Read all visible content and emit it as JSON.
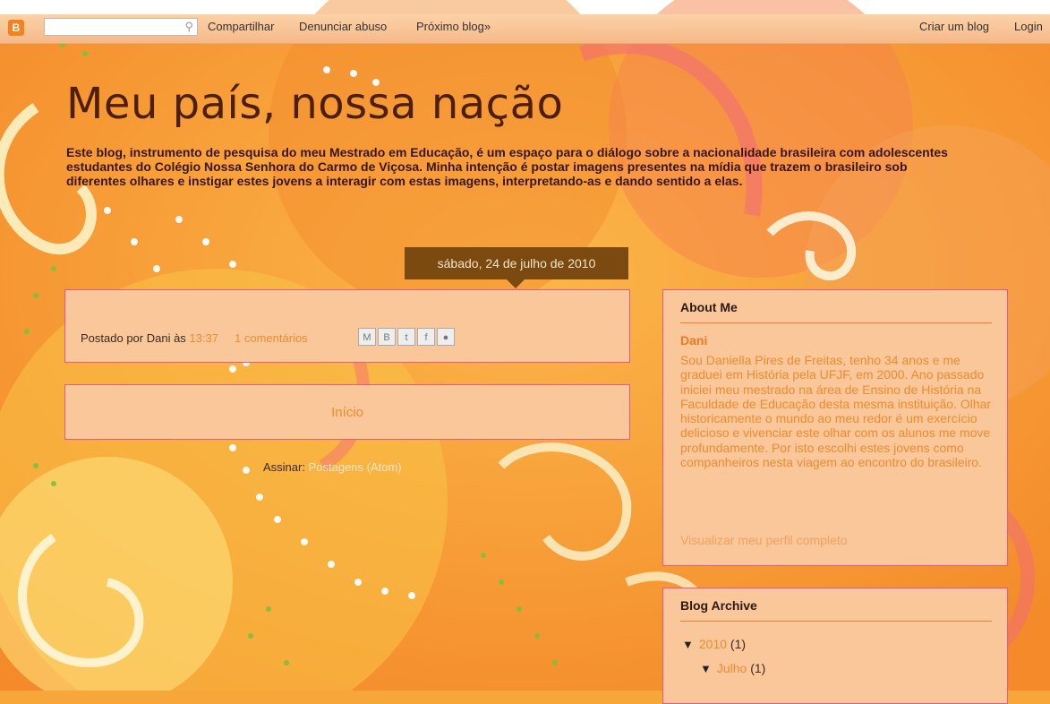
{
  "navbar": {
    "logo_letter": "B",
    "search_placeholder": "",
    "links": {
      "share": "Compartilhar",
      "report": "Denunciar abuso",
      "next": "Próximo blog»",
      "create": "Criar um blog",
      "login": "Login"
    }
  },
  "header": {
    "title": "Meu país, nossa nação",
    "description": "Este blog, instrumento de pesquisa do meu Mestrado em Educação, é um espaço para o diálogo sobre a nacionalidade brasileira com adolescentes estudantes do Colégio Nossa Senhora do Carmo de Viçosa. Minha intenção é postar imagens presentes na mídia que trazem o brasileiro sob diferentes olhares e instigar estes jovens a interagir com estas imagens, interpretando-as e dando sentido a elas."
  },
  "post": {
    "date": "sábado, 24 de julho de 2010",
    "posted_by": "Postado por Dani às",
    "time": "13:37",
    "comments": "1 comentários",
    "share_icons": [
      "email-icon",
      "blogger-icon",
      "twitter-icon",
      "facebook-icon",
      "buzz-icon"
    ],
    "share_glyphs": [
      "M",
      "B",
      "t",
      "f",
      "●"
    ]
  },
  "nav": {
    "home": "Início",
    "subscribe_label": "Assinar:",
    "subscribe_link": "Postagens (Atom)"
  },
  "sidebar": {
    "about": {
      "title": "About Me",
      "name": "Dani",
      "bio": "Sou Daniella Pires de Freitas, tenho 34 anos e me graduei em História pela UFJF, em 2000. Ano passado iniciei meu mestrado na área de Ensino de História na Faculdade de Educação desta mesma instituição. Olhar historicamente o mundo ao meu redor é um exercício delicioso e vivenciar este olhar com os alunos me move profundamente. Por isto escolhi estes jovens como companheiros nesta viagem ao encontro do brasileiro.",
      "profile_link": "Visualizar meu perfil completo"
    },
    "archive": {
      "title": "Blog Archive",
      "year": "2010",
      "year_count": "(1)",
      "month": "Julho",
      "month_count": "(1)",
      "toggle": "▼"
    }
  },
  "colors": {
    "background": "#f7a73a",
    "title": "#4c1f06",
    "panel": "#f9c79a",
    "panel_border": "#e55a8a",
    "link": "#ee8c2f",
    "date_badge": "#7a4a11"
  }
}
